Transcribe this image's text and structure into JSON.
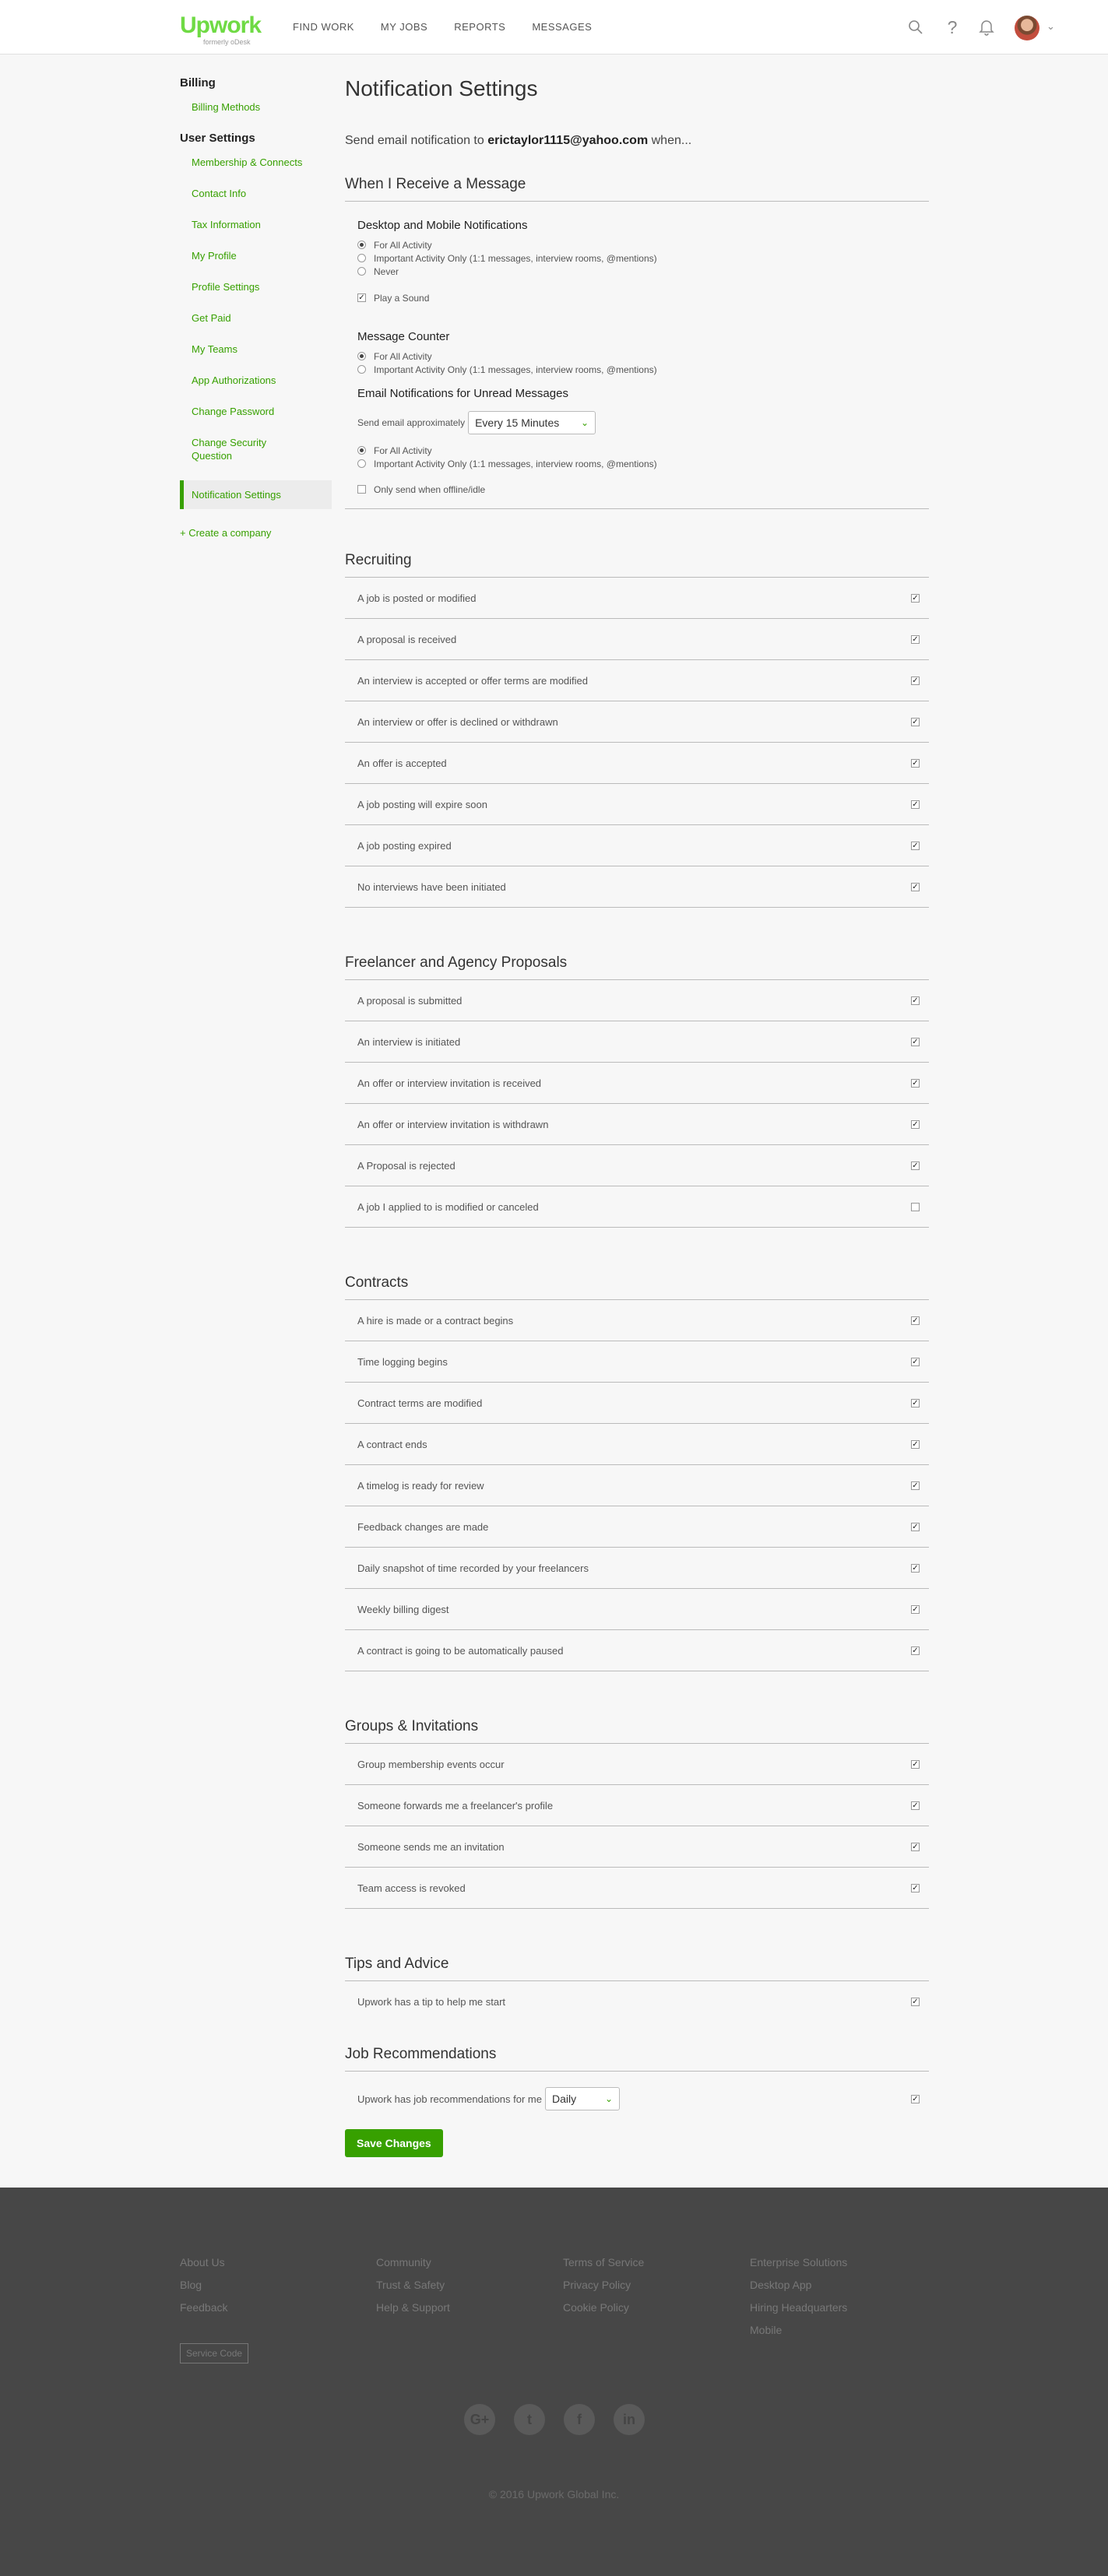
{
  "header": {
    "logo": "Upwork",
    "logo_sub": "formerly oDesk",
    "nav": [
      "FIND WORK",
      "MY JOBS",
      "REPORTS",
      "MESSAGES"
    ]
  },
  "sidebar": {
    "billing_heading": "Billing",
    "billing_items": [
      "Billing Methods"
    ],
    "user_heading": "User Settings",
    "items": [
      "Membership & Connects",
      "Contact Info",
      "Tax Information",
      "My Profile",
      "Profile Settings",
      "Get Paid",
      "My Teams",
      "App Authorizations",
      "Change Password",
      "Change Security Question",
      "Notification Settings"
    ],
    "create": "+ Create a company"
  },
  "main": {
    "title": "Notification Settings",
    "lead_prefix": "Send email notification to",
    "email": "erictaylor1115@yahoo.com",
    "lead_suffix": "when...",
    "receive": {
      "title": "When I Receive a Message",
      "desktop_title": "Desktop and Mobile Notifications",
      "desktop_options": [
        {
          "label": "For All Activity",
          "selected": true
        },
        {
          "label": "Important Activity Only (1:1 messages, interview rooms, @mentions)",
          "selected": false
        },
        {
          "label": "Never",
          "selected": false
        }
      ],
      "play_sound": {
        "label": "Play a Sound",
        "checked": true
      },
      "counter_title": "Message Counter",
      "counter_options": [
        {
          "label": "For All Activity",
          "selected": true
        },
        {
          "label": "Important Activity Only (1:1 messages, interview rooms, @mentions)",
          "selected": false
        }
      ],
      "email_title": "Email Notifications for Unread Messages",
      "email_approx_label": "Send email approximately",
      "email_approx_value": "Every 15 Minutes",
      "email_options": [
        {
          "label": "For All Activity",
          "selected": true
        },
        {
          "label": "Important Activity Only (1:1 messages, interview rooms, @mentions)",
          "selected": false
        }
      ],
      "offline": {
        "label": "Only send when offline/idle",
        "checked": false
      }
    },
    "recruiting": {
      "title": "Recruiting",
      "rows": [
        {
          "label": "A job is posted or modified",
          "checked": true
        },
        {
          "label": "A proposal is received",
          "checked": true
        },
        {
          "label": "An interview is accepted or offer terms are modified",
          "checked": true
        },
        {
          "label": "An interview or offer is declined or withdrawn",
          "checked": true
        },
        {
          "label": "An offer is accepted",
          "checked": true
        },
        {
          "label": "A job posting will expire soon",
          "checked": true
        },
        {
          "label": "A job posting expired",
          "checked": true
        },
        {
          "label": "No interviews have been initiated",
          "checked": true
        }
      ]
    },
    "proposals": {
      "title": "Freelancer and Agency Proposals",
      "rows": [
        {
          "label": "A proposal is submitted",
          "checked": true
        },
        {
          "label": "An interview is initiated",
          "checked": true
        },
        {
          "label": "An offer or interview invitation is received",
          "checked": true
        },
        {
          "label": "An offer or interview invitation is withdrawn",
          "checked": true
        },
        {
          "label": "A Proposal is rejected",
          "checked": true
        },
        {
          "label": "A job I applied to is modified or canceled",
          "checked": false
        }
      ]
    },
    "contracts": {
      "title": "Contracts",
      "rows": [
        {
          "label": "A hire is made or a contract begins",
          "checked": true
        },
        {
          "label": "Time logging begins",
          "checked": true
        },
        {
          "label": "Contract terms are modified",
          "checked": true
        },
        {
          "label": "A contract ends",
          "checked": true
        },
        {
          "label": "A timelog is ready for review",
          "checked": true
        },
        {
          "label": "Feedback changes are made",
          "checked": true
        },
        {
          "label": "Daily snapshot of time recorded by your freelancers",
          "checked": true
        },
        {
          "label": "Weekly billing digest",
          "checked": true
        },
        {
          "label": "A contract is going to be automatically paused",
          "checked": true
        }
      ]
    },
    "groups": {
      "title": "Groups & Invitations",
      "rows": [
        {
          "label": "Group membership events occur",
          "checked": true
        },
        {
          "label": "Someone forwards me a freelancer's profile",
          "checked": true
        },
        {
          "label": "Someone sends me an invitation",
          "checked": true
        },
        {
          "label": "Team access is revoked",
          "checked": true
        }
      ]
    },
    "tips": {
      "title": "Tips and Advice",
      "rows": [
        {
          "label": "Upwork has a tip to help me start",
          "checked": true
        }
      ]
    },
    "jobs": {
      "title": "Job Recommendations",
      "label": "Upwork has job recommendations for me",
      "frequency": "Daily",
      "checked": true
    },
    "save_label": "Save Changes"
  },
  "footer": {
    "col1": [
      "About Us",
      "Blog",
      "Feedback"
    ],
    "col2": [
      "Community",
      "Trust & Safety",
      "Help & Support"
    ],
    "col3": [
      "Terms of Service",
      "Privacy Policy",
      "Cookie Policy"
    ],
    "col4": [
      "Enterprise Solutions",
      "Desktop App",
      "Hiring Headquarters",
      "Mobile"
    ],
    "service_code": "Service Code",
    "social": [
      "G+",
      "t",
      "f",
      "in"
    ],
    "copyright": "© 2016 Upwork Global Inc."
  }
}
